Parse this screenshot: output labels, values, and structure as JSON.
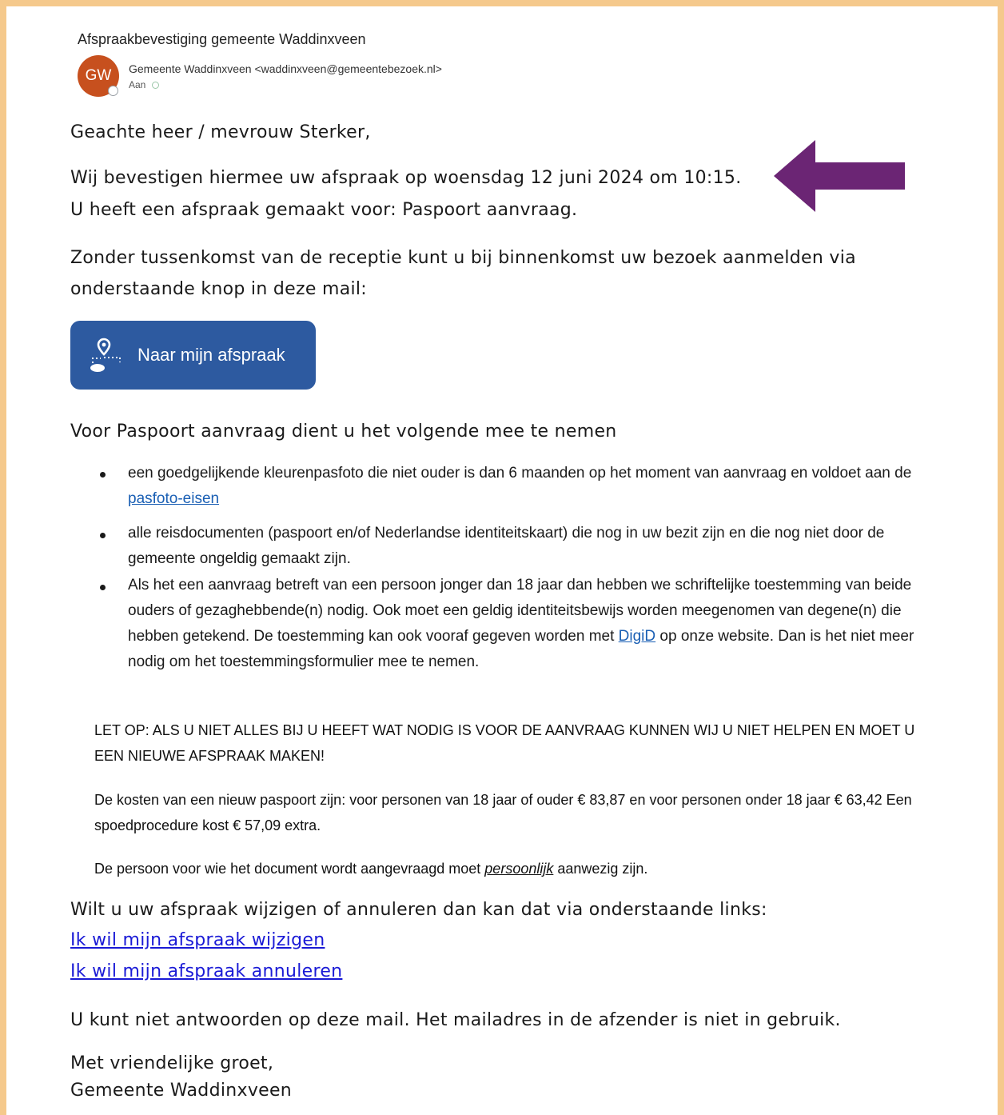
{
  "email": {
    "subject": "Afspraakbevestiging gemeente Waddinxveen",
    "avatar_initials": "GW",
    "sender": "Gemeente Waddinxveen <waddinxveen@gemeentebezoek.nl>",
    "to_label": "Aan"
  },
  "body": {
    "greeting": "Geachte heer / mevrouw Sterker,",
    "confirm_line": "Wij bevestigen hiermee uw afspraak op woensdag 12 juni 2024 om 10:15.",
    "made_for_line": "U heeft een afspraak gemaakt voor: Paspoort aanvraag.",
    "reception_line_1": "Zonder tussenkomst van de receptie kunt u bij binnenkomst uw bezoek aanmelden via",
    "reception_line_2": "onderstaande knop in deze mail:",
    "button_label": "Naar mijn afspraak",
    "bring_heading": "Voor Paspoort aanvraag dient u het volgende mee te nemen",
    "item1_text": "een goedgelijkende kleurenpasfoto die niet ouder is dan 6 maanden op het moment van aanvraag en voldoet aan de ",
    "item1_link": "pasfoto-eisen",
    "item2_text": "alle reisdocumenten (paspoort en/of Nederlandse identiteitskaart) die nog in uw bezit zijn en die nog niet door de gemeente ongeldig gemaakt zijn.",
    "item3_text_a": "Als het een aanvraag betreft van een persoon jonger dan 18 jaar dan hebben we schriftelijke toestemming van beide ouders of gezaghebbende(n) nodig. Ook moet een geldig identiteitsbewijs worden meegenomen van degene(n) die hebben getekend. De toestemming kan ook vooraf gegeven worden met ",
    "item3_link": "DigiD",
    "item3_text_b": " op onze website. Dan is het niet meer nodig om het toestemmingsformulier mee te nemen.",
    "warning": "LET OP: ALS U NIET ALLES BIJ U HEEFT WAT NODIG IS VOOR DE AANVRAAG KUNNEN WIJ U NIET HELPEN EN MOET U EEN NIEUWE AFSPRAAK MAKEN!",
    "costs": "De kosten van een nieuw paspoort zijn: voor personen van 18 jaar of ouder € 83,87 en voor personen onder 18 jaar € 63,42 Een spoedprocedure kost € 57,09 extra.",
    "presence_a": "De persoon voor wie het document wordt aangevraagd moet ",
    "presence_em": "persoonlijk",
    "presence_b": " aanwezig zijn.",
    "change_line": "Wilt u uw afspraak wijzigen of annuleren dan kan dat via onderstaande links:",
    "link_change": "Ik wil mijn afspraak wijzigen",
    "link_cancel": "Ik wil mijn afspraak annuleren",
    "noreply": "U kunt niet antwoorden op deze mail. Het mailadres in de afzender is niet in gebruik.",
    "closing": "Met vriendelijke groet,",
    "signature": "Gemeente Waddinxveen"
  },
  "colors": {
    "frame": "#f5c98c",
    "avatar": "#c7501e",
    "button": "#2d5aa0",
    "arrow": "#6b2574",
    "link": "#1a5fb4"
  }
}
